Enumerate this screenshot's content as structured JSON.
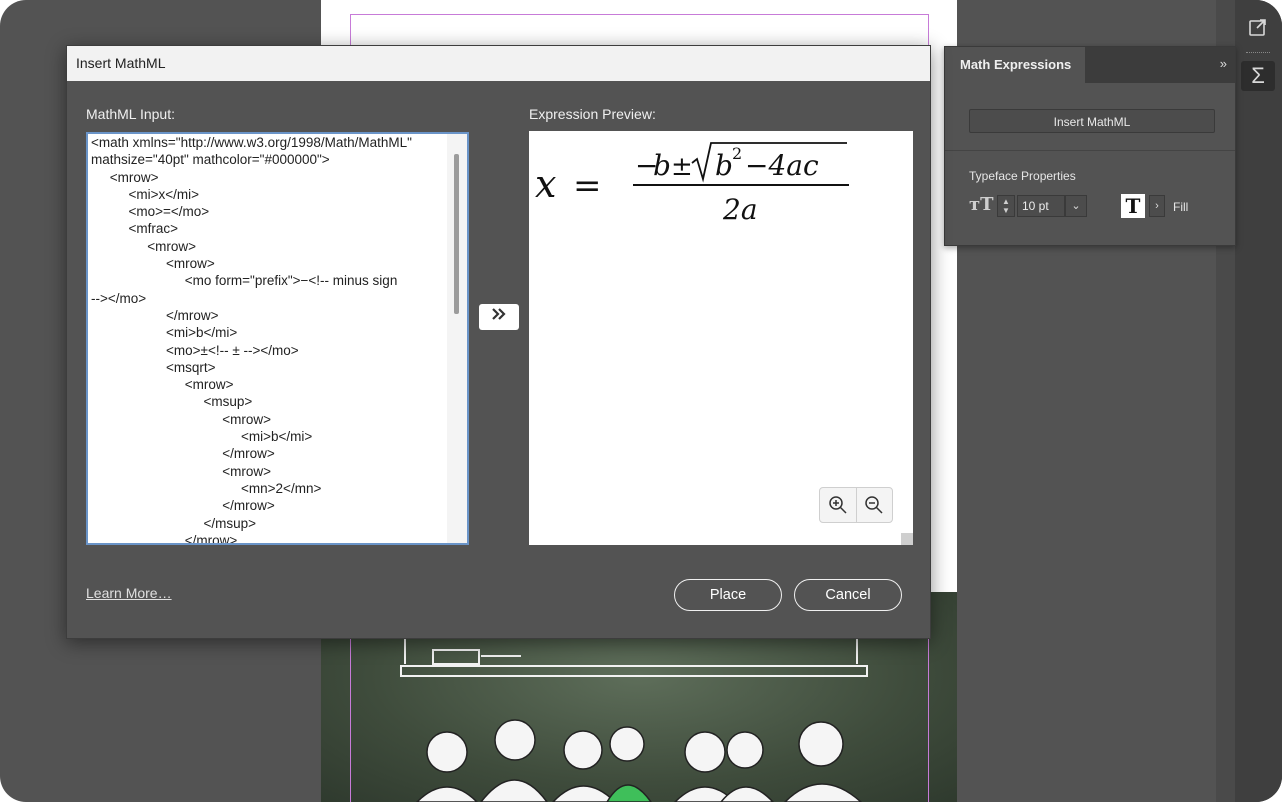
{
  "dialog": {
    "title": "Insert MathML",
    "input_label": "MathML Input:",
    "preview_label": "Expression Preview:",
    "mathml_code": "<math xmlns=\"http://www.w3.org/1998/Math/MathML\"\nmathsize=\"40pt\" mathcolor=\"#000000\">\n     <mrow>\n          <mi>x</mi>\n          <mo>=</mo>\n          <mfrac>\n               <mrow>\n                    <mrow>\n                         <mo form=\"prefix\">−<!-- minus sign\n--></mo>\n                    </mrow>\n                    <mi>b</mi>\n                    <mo>±<!-- ± --></mo>\n                    <msqrt>\n                         <mrow>\n                              <msup>\n                                   <mrow>\n                                        <mi>b</mi>\n                                   </mrow>\n                                   <mrow>\n                                        <mn>2</mn>\n                                   </mrow>\n                              </msup>\n                         </mrow>",
    "transfer_icon": "double-chevron-right-icon",
    "preview": {
      "variable": "x",
      "equals": "=",
      "minus": "−",
      "b": "b",
      "plus_minus": "±",
      "radicand_b": "b",
      "exponent": "2",
      "minus_4ac": "−4ac",
      "denominator": "2a"
    },
    "zoom_in_icon": "zoom-in-icon",
    "zoom_out_icon": "zoom-out-icon",
    "learn_more": "Learn More…",
    "place_label": "Place",
    "cancel_label": "Cancel"
  },
  "math_panel": {
    "title": "Math Expressions",
    "collapse_glyph": "»",
    "insert_button": "Insert MathML",
    "typeface_title": "Typeface Properties",
    "font_size": "10 pt",
    "fill_label": "Fill",
    "fill_swatch_glyph": "T",
    "font_size_icon_glyph": "тT",
    "dropdown_glyph": "⌄",
    "fill_chevron_glyph": "›"
  },
  "toolbar": {
    "export_icon": "export-icon",
    "sigma_icon": "sigma-icon",
    "sigma_glyph": "Σ"
  },
  "colors": {
    "app_bg": "#535353",
    "dialog_title_bg": "#f2f2f2",
    "input_focus_border": "#6a94c8",
    "margin_guide": "#c77bd8"
  }
}
